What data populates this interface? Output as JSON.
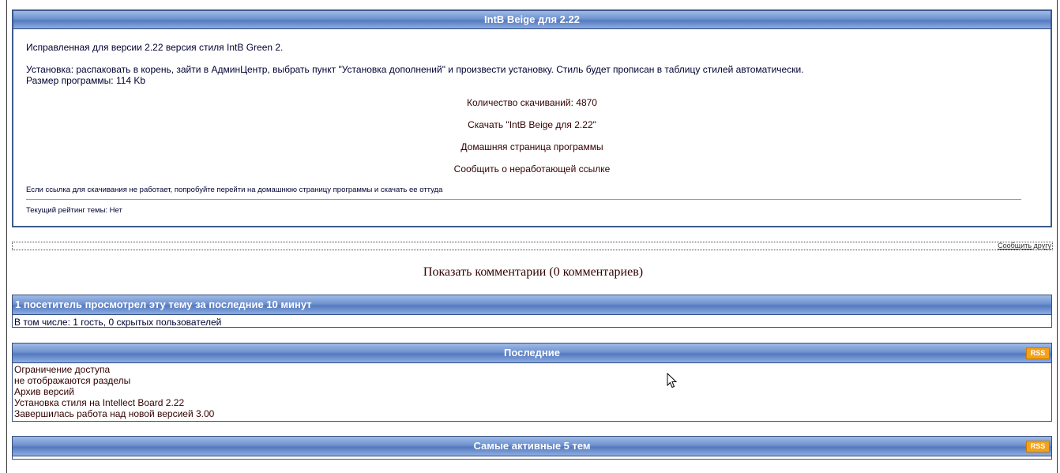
{
  "main": {
    "title": "IntB Beige для 2.22",
    "desc": "Исправленная для версии 2.22 версия стиля IntB Green 2.",
    "install": "Установка: распаковать в корень, зайти в АдминЦентр, выбрать пункт \"Установка дополнений\" и произвести установку. Стиль будет прописан в таблицу стилей автоматически.",
    "size": "Размер программы: 114 Kb",
    "downloads": "Количество скачиваний: 4870",
    "download_link": "Скачать \"IntB Beige для 2.22\"",
    "homepage_link": "Домашняя страница программы",
    "report_link": "Сообщить о неработающей ссылке",
    "note": "Если ссылка для скачивания не работает, попробуйте перейти на домашнюю страницу программы и скачать ее оттуда",
    "rating": "Текущий рейтинг темы: Нет"
  },
  "tell_friend": "Сообщить другу",
  "show_comments": "Показать комментарии (0 комментариев)",
  "visitors": {
    "title": "1 посетитель просмотрел эту тему за последние 10 минут",
    "body": "В том числе: 1 гость, 0 скрытых пользователей"
  },
  "latest": {
    "title": "Последние",
    "rss": "RSS",
    "items": [
      "Ограничение доступа",
      "не отображаются разделы",
      "Архив версий",
      "Установка стиля на Intellect Board 2.22",
      "Завершилась работа над новой версией 3.00"
    ]
  },
  "active": {
    "title": "Самые активные 5 тем",
    "rss": "RSS"
  },
  "colors": {
    "header_blue": "#6f92cf",
    "border": "#384f7a",
    "link": "#330000",
    "text": "#000033",
    "rss_orange": "#f4a21a"
  }
}
